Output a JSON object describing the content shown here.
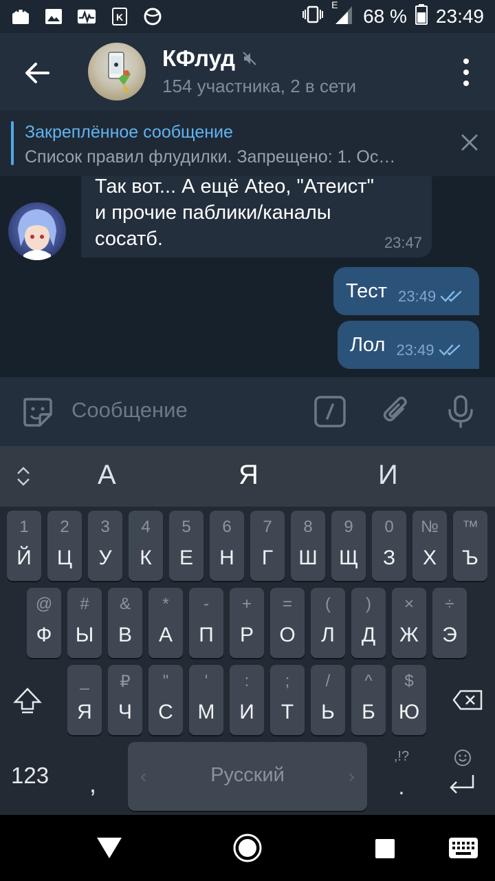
{
  "status_bar": {
    "left_icons": [
      "android-icon",
      "image-icon",
      "pulse-icon",
      "k-icon",
      "globe-sync-icon"
    ],
    "network": "E",
    "battery": "68 %",
    "time": "23:49"
  },
  "header": {
    "title": "КФлуд",
    "muted": true,
    "subtitle": "154 участника, 2 в сети"
  },
  "pinned": {
    "title": "Закреплённое сообщение",
    "text": "Список правил флудилки.  Запрещено: 1. Ос…"
  },
  "messages": {
    "incoming": {
      "text": "Так вот... А ещё Ateo, \"Атеист\"\nи прочие паблики/каналы\nсосатб.",
      "time": "23:47"
    },
    "outgoing": [
      {
        "text": "Тест",
        "time": "23:49"
      },
      {
        "text": "Лол",
        "time": "23:49"
      }
    ]
  },
  "composer": {
    "placeholder": "Сообщение"
  },
  "keyboard": {
    "suggestions": [
      "А",
      "Я",
      "И"
    ],
    "row1": [
      {
        "sec": "1",
        "pri": "Й"
      },
      {
        "sec": "2",
        "pri": "Ц"
      },
      {
        "sec": "3",
        "pri": "У"
      },
      {
        "sec": "4",
        "pri": "К"
      },
      {
        "sec": "5",
        "pri": "Е"
      },
      {
        "sec": "6",
        "pri": "Н"
      },
      {
        "sec": "7",
        "pri": "Г"
      },
      {
        "sec": "8",
        "pri": "Ш"
      },
      {
        "sec": "9",
        "pri": "Щ"
      },
      {
        "sec": "0",
        "pri": "З"
      },
      {
        "sec": "№",
        "pri": "Х"
      },
      {
        "sec": "™",
        "pri": "Ъ"
      }
    ],
    "row2": [
      {
        "sec": "@",
        "pri": "Ф"
      },
      {
        "sec": "#",
        "pri": "Ы"
      },
      {
        "sec": "&",
        "pri": "В"
      },
      {
        "sec": "*",
        "pri": "А"
      },
      {
        "sec": "-",
        "pri": "П"
      },
      {
        "sec": "+",
        "pri": "Р"
      },
      {
        "sec": "=",
        "pri": "О"
      },
      {
        "sec": "(",
        "pri": "Л"
      },
      {
        "sec": ")",
        "pri": "Д"
      },
      {
        "sec": "×",
        "pri": "Ж"
      },
      {
        "sec": "÷",
        "pri": "Э"
      }
    ],
    "row3": [
      {
        "sec": "_",
        "pri": "Я"
      },
      {
        "sec": "₽",
        "pri": "Ч"
      },
      {
        "sec": "\"",
        "pri": "С"
      },
      {
        "sec": "'",
        "pri": "М"
      },
      {
        "sec": ":",
        "pri": "И"
      },
      {
        "sec": ";",
        "pri": "Т"
      },
      {
        "sec": "/",
        "pri": "Ь"
      },
      {
        "sec": "^",
        "pri": "Б"
      },
      {
        "sec": "$",
        "pri": "Ю"
      }
    ],
    "num_label": "123",
    "comma": ",",
    "space_label": "Русский",
    "punct_label": ",!?",
    "period": ".",
    "colors": {
      "key": "#3f4852",
      "background": "#222a33"
    }
  },
  "colors": {
    "accent": "#4fa9e8",
    "header_bg": "#242f3d",
    "chat_bg": "#17212b",
    "outgoing_bubble": "#2b5278",
    "incoming_bubble": "#242f3d"
  }
}
